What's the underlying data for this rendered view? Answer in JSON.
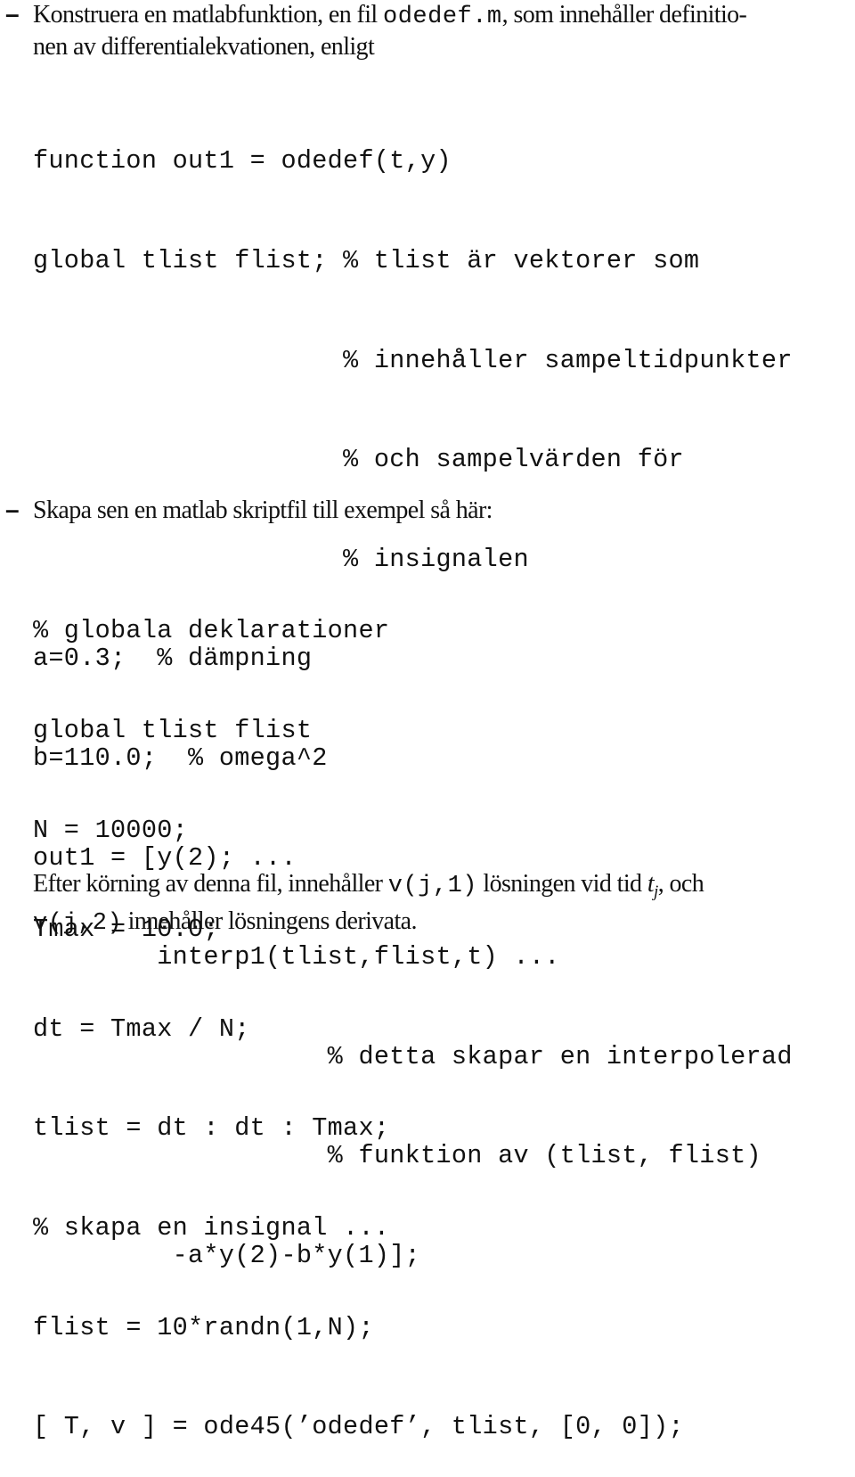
{
  "item1": {
    "bullet": "–",
    "text_before": "Konstruera en matlabfunktion, en fil ",
    "filename": "odedef.m",
    "text_after_line1": ", som innehåller definitio-",
    "text_line2": "nen av differentialekvationen, enligt"
  },
  "code1": {
    "lines": [
      "function out1 = odedef(t,y)",
      "global tlist flist; % tlist är vektorer som",
      "                    % innehåller sampeltidpunkter",
      "                    % och sampelvärden för",
      "                    % insignalen",
      "a=0.3;  % dämpning",
      "b=110.0;  % omega^2",
      "out1 = [y(2); ...",
      "        interp1(tlist,flist,t) ...",
      "                   % detta skapar en interpolerad",
      "                   % funktion av (tlist, flist)",
      "         -a*y(2)-b*y(1)];"
    ]
  },
  "item2": {
    "bullet": "–",
    "text": "Skapa sen en matlab skriptfil till exempel så här:"
  },
  "code2": {
    "lines": [
      "% globala deklarationer",
      "global tlist flist",
      "N = 10000;",
      "Tmax = 10.0;",
      "dt = Tmax / N;",
      "tlist = dt : dt : Tmax;",
      "% skapa en insignal ...",
      "flist = 10*randn(1,N);",
      "[ T, v ] = ode45(’odedef’, tlist, [0, 0]);"
    ]
  },
  "conclusion": {
    "part1": "Efter körning av denna fil, innehåller ",
    "code_a": "v(j,1)",
    "part2": " lösningen vid tid ",
    "math_t": "t",
    "math_sub": "j",
    "part3": ", och",
    "code_b": "v(j,2)",
    "part4": " innehåller lösningens derivata."
  }
}
